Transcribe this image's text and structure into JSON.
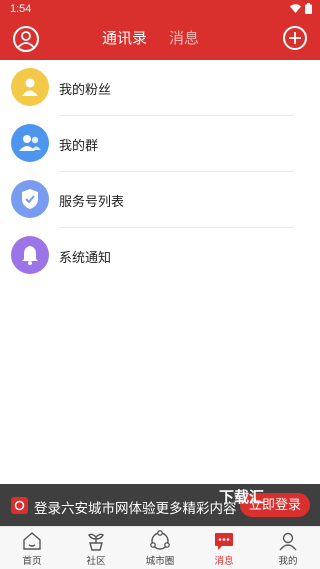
{
  "status_bar": {
    "time": "1:54"
  },
  "header": {
    "tabs": [
      {
        "label": "通讯录",
        "active": true
      },
      {
        "label": "消息",
        "active": false
      }
    ]
  },
  "contacts": [
    {
      "label": "我的粉丝",
      "icon": "fans-icon",
      "color": "#f4c94a"
    },
    {
      "label": "我的群",
      "icon": "group-icon",
      "color": "#4d95ee"
    },
    {
      "label": "服务号列表",
      "icon": "shield-check-icon",
      "color": "#7a9cf0"
    },
    {
      "label": "系统通知",
      "icon": "bell-icon",
      "color": "#9b74e8"
    }
  ],
  "banner": {
    "text": "登录六安城市网体验更多精彩内容",
    "login_label": "立即登录",
    "watermark": "下载汇"
  },
  "bottom_nav": [
    {
      "label": "首页",
      "icon": "home-icon",
      "active": false
    },
    {
      "label": "社区",
      "icon": "sprout-icon",
      "active": false
    },
    {
      "label": "城市圈",
      "icon": "city-circle-icon",
      "active": false
    },
    {
      "label": "消息",
      "icon": "message-icon",
      "active": true
    },
    {
      "label": "我的",
      "icon": "person-icon",
      "active": false
    }
  ],
  "colors": {
    "brand": "#d9302e"
  }
}
